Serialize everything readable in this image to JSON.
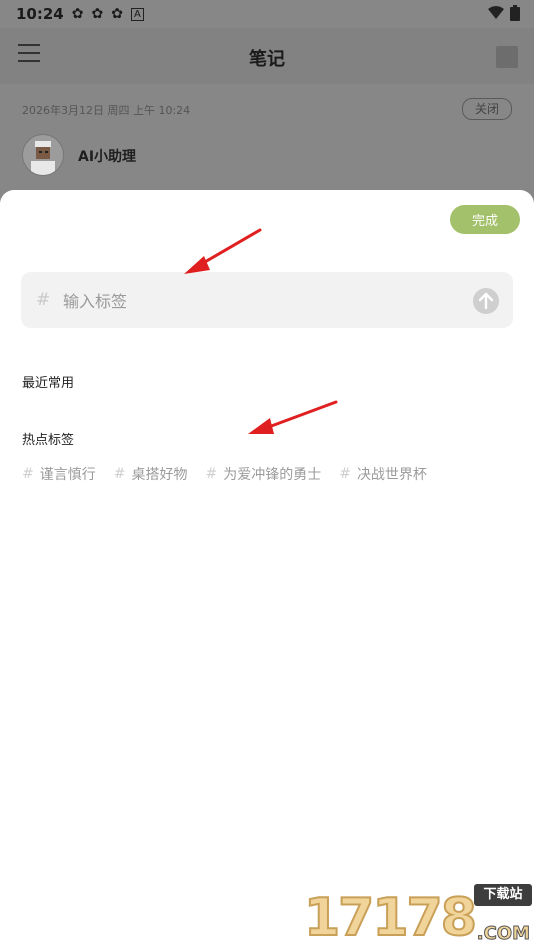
{
  "status_bar": {
    "time": "10:24",
    "icons": [
      "sync-icon",
      "sync-icon",
      "sync-icon",
      "a-icon"
    ],
    "right_icons": [
      "wifi-icon",
      "battery-icon"
    ]
  },
  "app_bar": {
    "title": "笔记",
    "menu_icon": "menu-icon",
    "square_icon": "square-icon"
  },
  "note": {
    "meta": "2026年3月12日 周四 上午 10:24",
    "close_label": "关闭",
    "assistant_name": "AI小助理"
  },
  "sheet": {
    "done_label": "完成",
    "input_placeholder": "输入标签",
    "input_value": "",
    "recent_title": "最近常用",
    "hot_title": "热点标签",
    "hot_tags": [
      "谨言慎行",
      "桌搭好物",
      "为爱冲锋的勇士",
      "决战世界杯"
    ]
  },
  "colors": {
    "accent_green": "#a3c06a",
    "arrow_red": "#e02020",
    "dim_background": "#878787"
  },
  "watermark": {
    "number": "17178",
    "badge": "下载站",
    "suffix": ".COM"
  }
}
